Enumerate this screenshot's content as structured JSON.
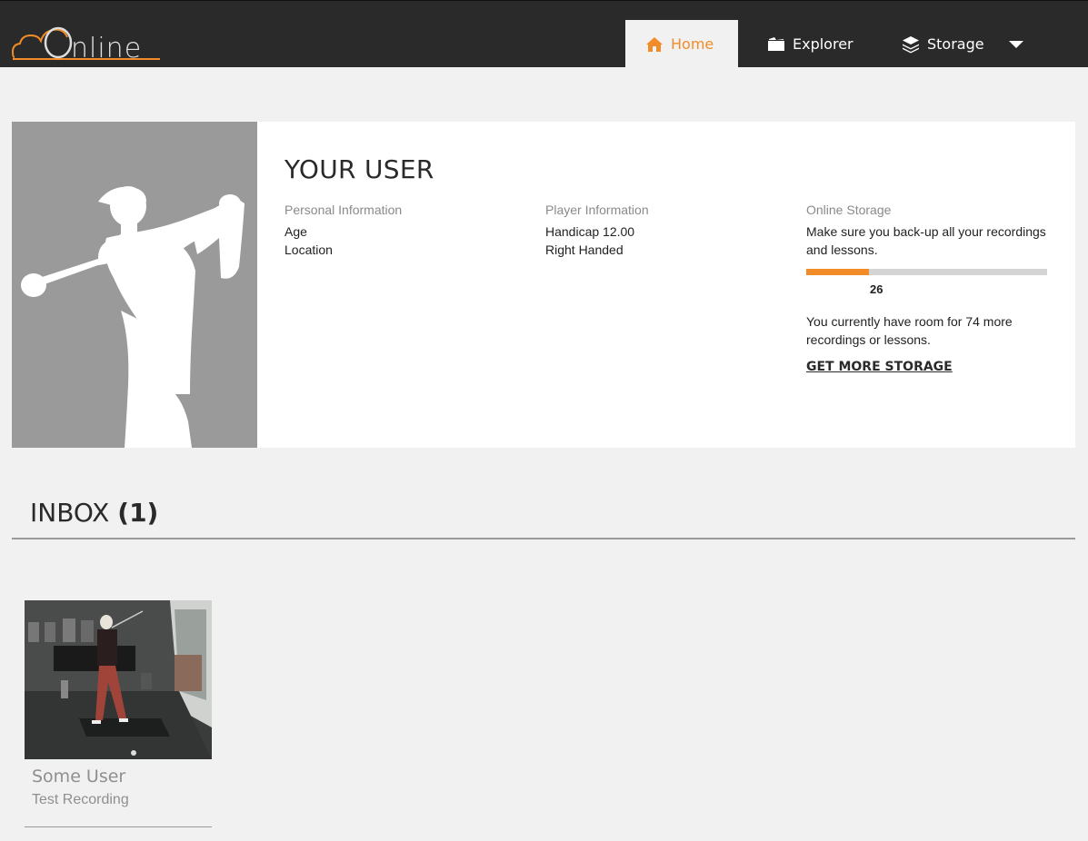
{
  "brand": {
    "logo_text": "Online",
    "accent": "#f28c28"
  },
  "nav": {
    "tabs": [
      {
        "label": "Home",
        "icon": "home-icon",
        "active": true
      },
      {
        "label": "Explorer",
        "icon": "folder-icon",
        "active": false
      },
      {
        "label": "Storage",
        "icon": "layers-icon",
        "active": false
      }
    ],
    "more_icon": "chevron-down-icon"
  },
  "profile": {
    "title": "YOUR USER",
    "personal": {
      "heading": "Personal Information",
      "lines": [
        "Age",
        "Location"
      ]
    },
    "player": {
      "heading": "Player Information",
      "lines": [
        "Handicap 12.00",
        "Right Handed"
      ]
    },
    "storage": {
      "heading": "Online Storage",
      "message": "Make sure you back-up all your recordings and lessons.",
      "used": 26,
      "used_fraction": 0.26,
      "room_text": "You currently have room for 74 more recordings or lessons.",
      "link": "GET MORE STORAGE"
    }
  },
  "inbox": {
    "title": "INBOX",
    "count": "(1)",
    "items": [
      {
        "name": "Some User",
        "subtitle": "Test Recording"
      }
    ]
  }
}
